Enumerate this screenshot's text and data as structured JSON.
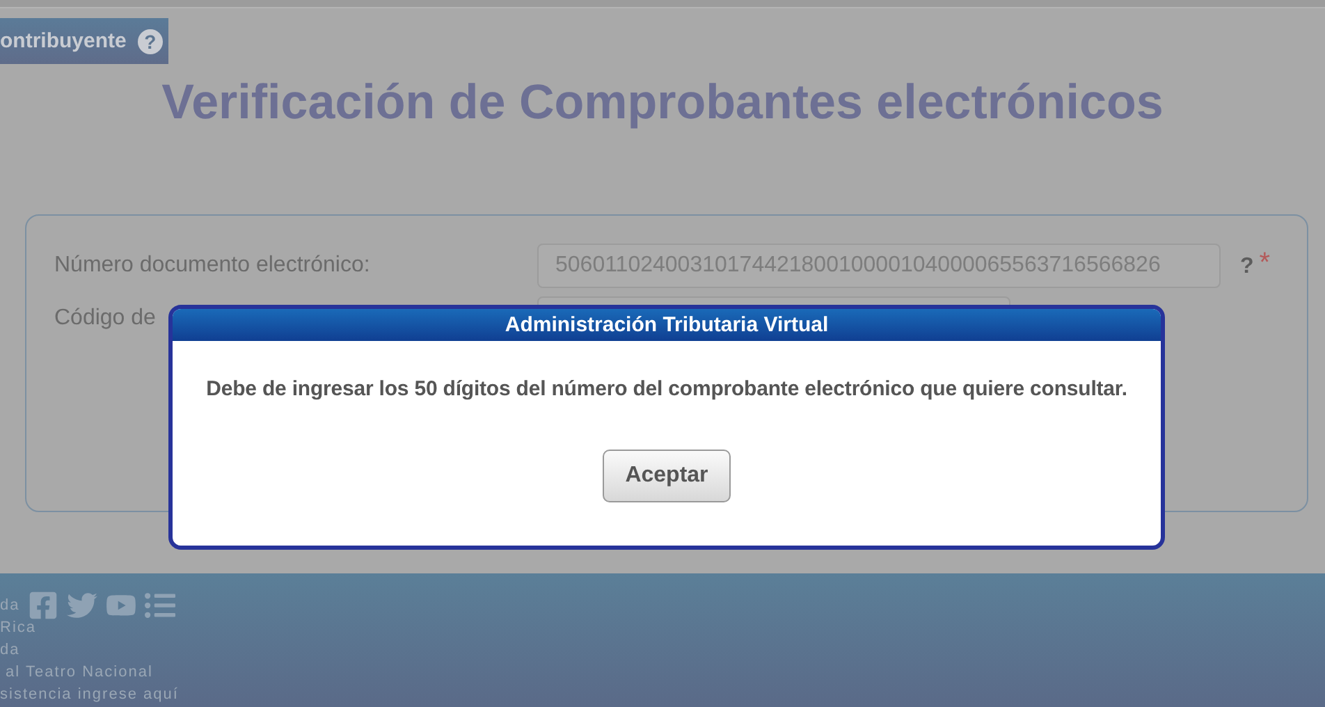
{
  "header": {
    "tab_label": "ontribuyente",
    "help": "?"
  },
  "title": "Verificación de Comprobantes electrónicos",
  "form": {
    "fields": [
      {
        "label": "Número documento electrónico:",
        "value": "5060110240031017442180010000104000065563716566826",
        "help": "?",
        "required_mark": "*"
      },
      {
        "label": "Código de"
      }
    ]
  },
  "dialog": {
    "title": "Administración Tributaria Virtual",
    "message": "Debe de ingresar los 50 dígitos del número del comprobante electrónico que quiere consultar.",
    "button": "Aceptar"
  },
  "footer": {
    "lines": [
      "da",
      "Rica",
      "da",
      " al Teatro Nacional",
      "sistencia ingrese aquí"
    ]
  }
}
